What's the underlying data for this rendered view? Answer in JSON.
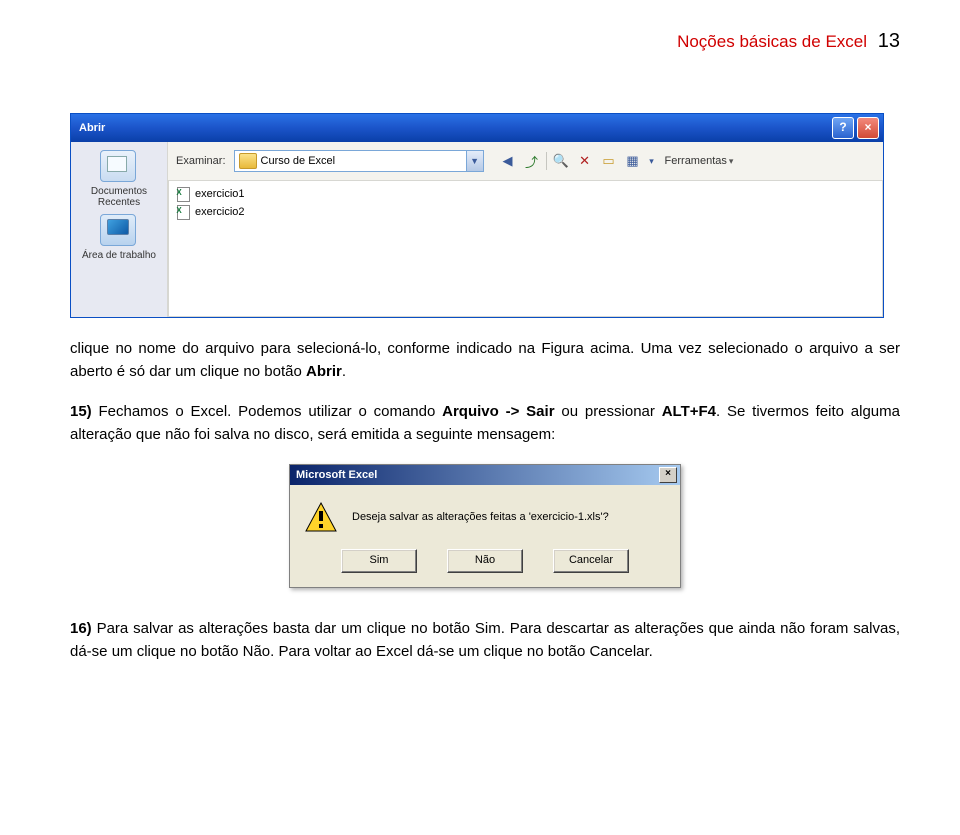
{
  "header": {
    "title": "Noções básicas de Excel",
    "page_number": "13"
  },
  "dialog": {
    "title": "Abrir",
    "help_symbol": "?",
    "close_symbol": "×",
    "examine_label": "Examinar:",
    "folder_selected": "Curso de Excel",
    "tools_label": "Ferramentas",
    "sidebar": {
      "recent": "Documentos Recentes",
      "desktop": "Área de trabalho"
    },
    "files": [
      "exercicio1",
      "exercicio2"
    ]
  },
  "paragraphs": {
    "p1_a": "clique no nome do arquivo para selecioná-lo, conforme indicado na Figura acima. Uma vez selecionado o arquivo a ser aberto é só dar um clique no botão ",
    "p1_b": "Abrir",
    "p1_c": ".",
    "p2_a": "15)",
    "p2_b": " Fechamos o Excel. Podemos utilizar o comando ",
    "p2_c": "Arquivo -> Sair",
    "p2_d": " ou pressionar ",
    "p2_e": "ALT+F4",
    "p2_f": ". Se tivermos feito alguma alteração que não foi salva no disco, será emitida a seguinte mensagem:",
    "p3_a": "16)",
    "p3_b": " Para salvar as alterações basta dar um clique no botão Sim. Para descartar as alterações que ainda não foram salvas, dá-se um clique no botão Não. Para voltar ao Excel dá-se um clique no botão Cancelar."
  },
  "msgbox": {
    "title": "Microsoft Excel",
    "close_symbol": "×",
    "text": "Deseja salvar as alterações feitas a 'exercicio-1.xls'?",
    "buttons": {
      "yes": "Sim",
      "no": "Não",
      "cancel": "Cancelar"
    }
  }
}
